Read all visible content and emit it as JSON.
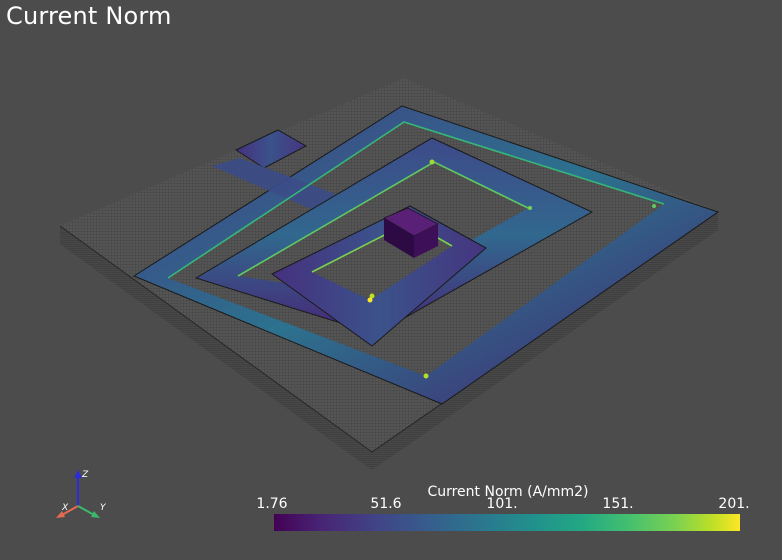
{
  "window": {
    "title": "Current Norm"
  },
  "axes_widget": {
    "x_label": "X",
    "y_label": "Y",
    "z_label": "Z"
  },
  "scalar_bar": {
    "title": "Current Norm (A/mm2)",
    "ticks": [
      "1.76",
      "51.6",
      "101.",
      "151.",
      "201."
    ],
    "colormap": "viridis",
    "colors": [
      "#440154",
      "#414487",
      "#2a788e",
      "#22a884",
      "#7ad151",
      "#fde725"
    ]
  },
  "colors": {
    "background": "#4c4c4c",
    "substrate_mesh": "#5a5a5a",
    "conductor_low": "#440154",
    "conductor_high": "#fde725"
  }
}
